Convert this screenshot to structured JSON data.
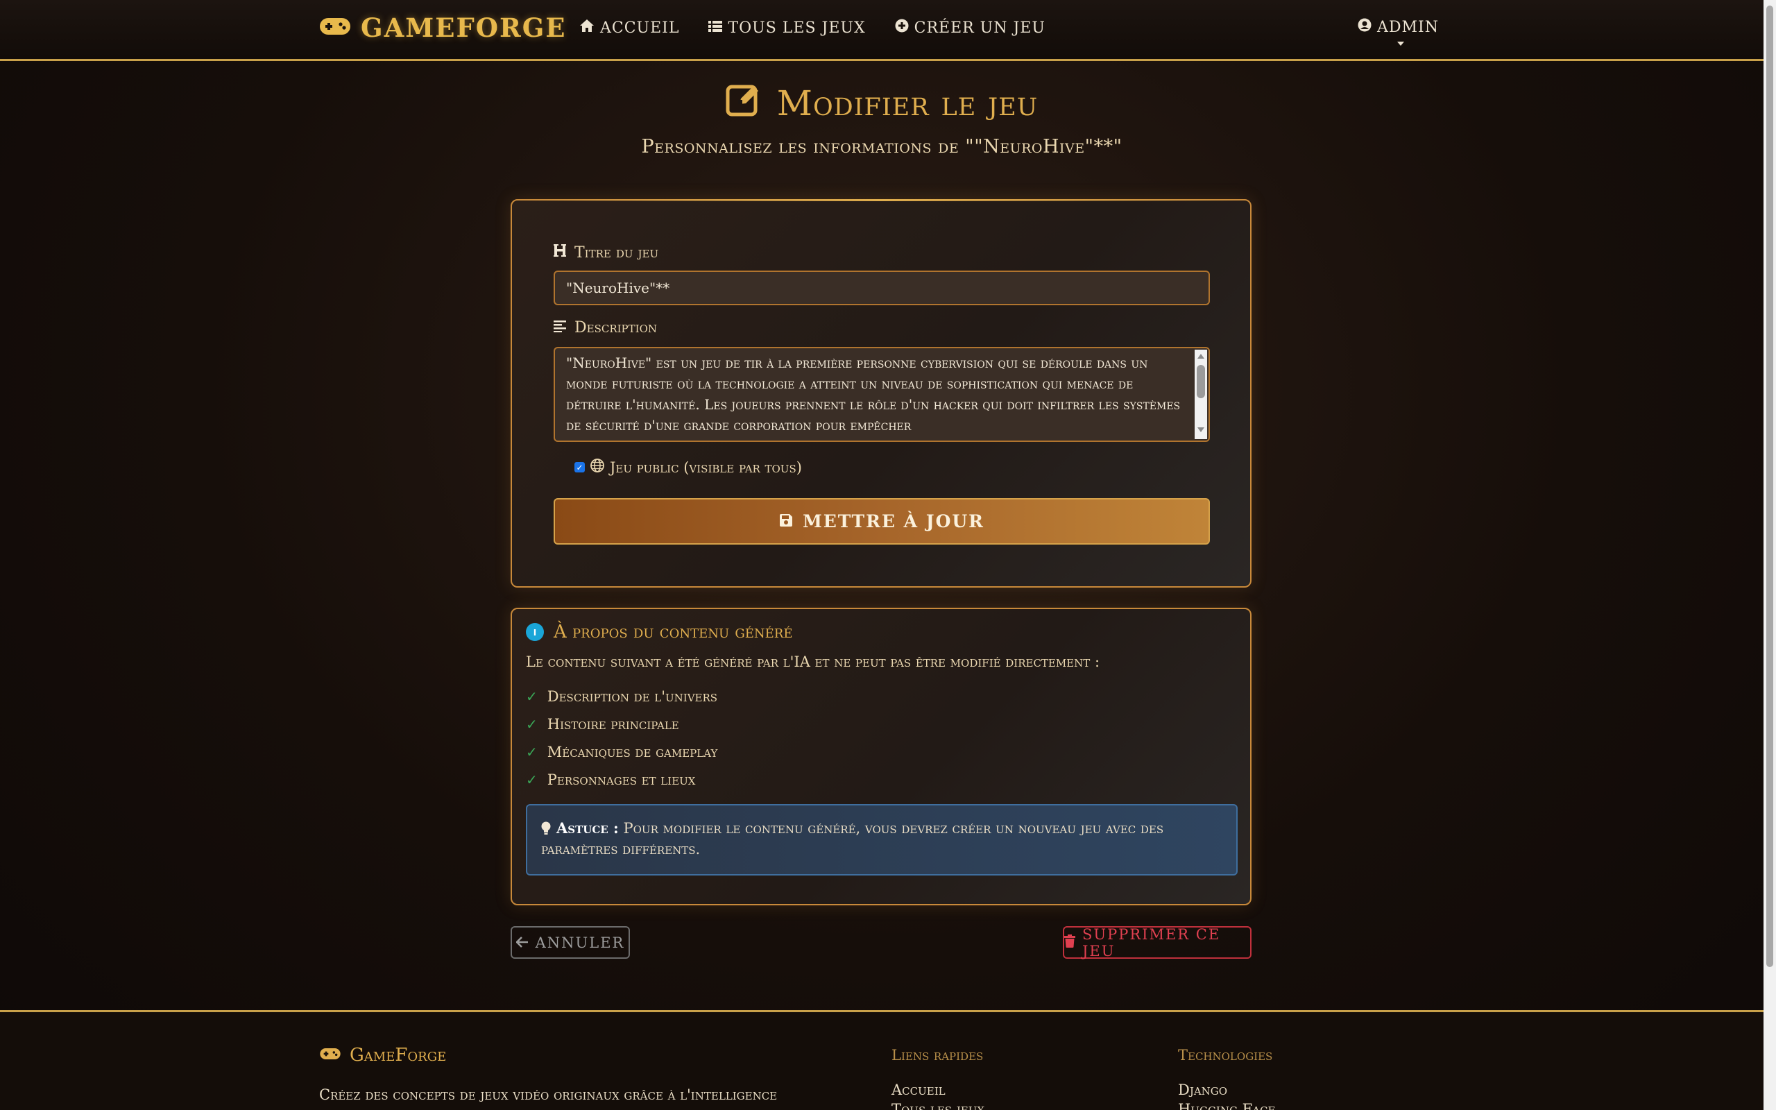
{
  "nav": {
    "brand": "GAMEFORGE",
    "brand_icon": "gamepad-icon",
    "links": [
      {
        "label": "ACCUEIL",
        "icon": "home-icon"
      },
      {
        "label": "TOUS LES JEUX",
        "icon": "list-icon"
      },
      {
        "label": "CRÉER UN JEU",
        "icon": "plus-circle-icon"
      }
    ],
    "user": {
      "label": "ADMIN",
      "icon": "user-circle-icon"
    }
  },
  "header": {
    "title": "Modifier le jeu",
    "subtitle": "Personnalisez les informations de \"\"NeuroHive\"**\""
  },
  "form": {
    "title_label": "Titre du jeu",
    "title_value": "\"NeuroHive\"**",
    "description_label": "Description",
    "description_value": "\"NeuroHive\" est un jeu de tir à la première personne cybervision qui se déroule dans un monde futuriste où la technologie a atteint un niveau de sophistication qui menace de détruire l'humanité. Les joueurs prennent le rôle d'un hacker qui doit infiltrer les systèmes de sécurité d'une grande corporation pour empêcher",
    "public_checked": true,
    "public_label": "Jeu public (visible par tous)",
    "submit_label": "METTRE À JOUR"
  },
  "info": {
    "title": "À propos du contenu généré",
    "text": "Le contenu suivant a été généré par l'IA et ne peut pas être modifié directement :",
    "items": [
      "Description de l'univers",
      "Histoire principale",
      "Mécaniques de gameplay",
      "Personnages et lieux"
    ],
    "tip_label": "Astuce :",
    "tip_text": "Pour modifier le contenu généré, vous devrez créer un nouveau jeu avec des paramètres différents."
  },
  "actions": {
    "cancel_label": "ANNULER",
    "delete_label": "SUPPRIMER CE JEU"
  },
  "footer": {
    "brand": "GameForge",
    "desc": "Créez des concepts de jeux vidéo originaux grâce à l'intelligence artificielle. Laissez libre cours à votre imagination !",
    "quick_links_title": "Liens rapides",
    "quick_links": [
      "Accueil",
      "Tous les jeux"
    ],
    "tech_title": "Technologies",
    "tech": [
      "Django",
      "Hugging Face"
    ]
  },
  "colors": {
    "accent": "#e0ae4e",
    "border": "#c8893a",
    "danger": "#e04050",
    "success": "#3aa657",
    "info": "#1aa6d8"
  }
}
